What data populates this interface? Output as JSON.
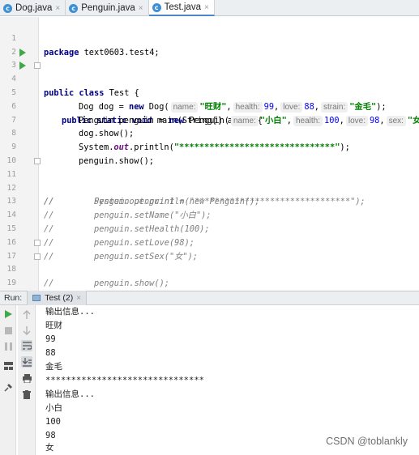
{
  "tabs": [
    {
      "label": "Dog.java",
      "close": "×"
    },
    {
      "label": "Penguin.java",
      "close": "×"
    },
    {
      "label": "Test.java",
      "close": "×"
    }
  ],
  "file_icon_letter": "c",
  "editor": {
    "line_numbers": [
      "1",
      "2",
      "3",
      "4",
      "5",
      "6",
      "7",
      "8",
      "9",
      "10",
      "11",
      "12",
      "13",
      "14",
      "15",
      "16",
      "17",
      "18",
      "19"
    ],
    "line1_kw": "package",
    "line1_rest": " text0603.test4;",
    "line3_kw": "public class",
    "line3_rest": " Test {",
    "line4_kw": "public static void",
    "line4_rest": " main(String[] args) {",
    "line5_a": "Dog dog = ",
    "line5_kw": "new",
    "line5_b": " Dog(",
    "line5_hint_name": "name:",
    "line5_name": "\"旺财\"",
    "line5_sep1": ",",
    "line5_hint_health": "health:",
    "line5_health": "99",
    "line5_sep2": ",",
    "line5_hint_love": "love:",
    "line5_love": "88",
    "line5_sep3": ",",
    "line5_hint_strain": "strain:",
    "line5_strain": "\"金毛\"",
    "line5_end": ");",
    "line6_a": "Penguin penguin = ",
    "line6_kw": "new",
    "line6_b": " Penguin(",
    "line6_hint_name": "name:",
    "line6_name": "\"小白\"",
    "line6_sep1": ",",
    "line6_hint_health": "health:",
    "line6_health": "100",
    "line6_sep2": ",",
    "line6_hint_love": "love:",
    "line6_love": "98",
    "line6_sep3": ",",
    "line6_hint_sex": "sex:",
    "line6_sex": "\"女\"",
    "line6_end": ");",
    "line7": "dog.show();",
    "line8_a": "System.",
    "line8_out": "out",
    "line8_b": ".println(",
    "line8_str": "\"*******************************\"",
    "line8_end": ");",
    "line9": "penguin.show();",
    "line11": "//        System.out.println(\"*******************************\");",
    "line12": "//        Penguin penguin1 = new Penguin();",
    "line13": "//        penguin.setName(\"小白\");",
    "line14": "//        penguin.setHealth(100);",
    "line15": "//        penguin.setLove(98);",
    "line16": "//        penguin.setSex(\"女\");",
    "line17": "//        penguin.show();",
    "line18": "}",
    "line19": "}"
  },
  "run_panel": {
    "label": "Run:",
    "tab": "Test (2)",
    "tab_close": "×",
    "output": [
      "输出信息...",
      "旺财",
      "99",
      "88",
      "金毛",
      "*******************************",
      "输出信息...",
      "小白",
      "100",
      "98",
      "女"
    ],
    "watermark": "CSDN @toblankly"
  },
  "icons": {
    "run": "run-icon",
    "stop": "stop-icon",
    "pause": "pause-icon",
    "layout": "layout-icon",
    "pin": "pin-icon",
    "up": "arrow-up-icon",
    "down": "arrow-down-icon",
    "wrap": "soft-wrap-icon",
    "scroll": "scroll-to-end-icon",
    "print": "print-icon",
    "trash": "trash-icon"
  },
  "colors": {
    "keyword": "#000080",
    "string": "#008000",
    "number": "#0000ff",
    "comment": "#808080",
    "run_green": "#3ea84b",
    "tab_accent": "#4a88c7"
  }
}
